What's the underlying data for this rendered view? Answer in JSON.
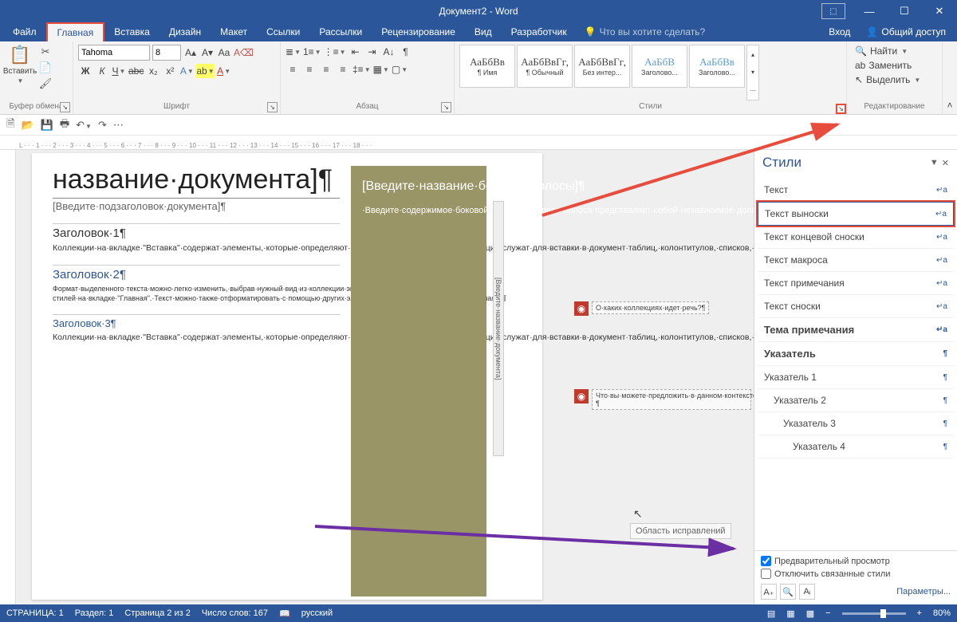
{
  "title": "Документ2 - Word",
  "window": {
    "restore": "🗗",
    "min": "—",
    "max": "☐",
    "close": "✕"
  },
  "tabs": [
    "Файл",
    "Главная",
    "Вставка",
    "Дизайн",
    "Макет",
    "Ссылки",
    "Рассылки",
    "Рецензирование",
    "Вид",
    "Разработчик"
  ],
  "activeTab": 1,
  "tellme": "Что вы хотите сделать?",
  "signin": "Вход",
  "share": "Общий доступ",
  "ribbon": {
    "clipboard": {
      "label": "Буфер обмена",
      "paste": "Вставить"
    },
    "font": {
      "label": "Шрифт",
      "name": "Tahoma",
      "size": "8"
    },
    "paragraph": {
      "label": "Абзац"
    },
    "styles": {
      "label": "Стили",
      "items": [
        {
          "prev": "АаБбВв",
          "name": "¶ Имя"
        },
        {
          "prev": "АаБбВвГг,",
          "name": "¶ Обычный"
        },
        {
          "prev": "АаБбВвГг,",
          "name": "Без интер..."
        },
        {
          "prev": "АаБбВ",
          "name": "Заголово..."
        },
        {
          "prev": "АаБбВв",
          "name": "Заголово..."
        }
      ]
    },
    "editing": {
      "label": "Редактирование",
      "find": "Найти",
      "replace": "Заменить",
      "select": "Выделить"
    }
  },
  "ruler": "L · · · 1 · · · 2 · · · 3 · · · 4 · · · 5 · · · 6 · · · 7 · · · 8 · · · 9 · · · 10 · · · 11 · · · 12 · · · 13 · · · 14 · · · 15 · · · 16 · · · 17 · · · 18 · · ·",
  "doc": {
    "title": "название·документа]¶",
    "subtitle": "[Введите·подзаголовок·документа]¶",
    "h1": "Заголовок·1¶",
    "p1": "Коллекции·на·вкладке·\"Вставка\"·содержат·элементы,·которые·определяют·общий·вид·документа.·Эти·коллекции·служат·для·вставки·в·документ·таблиц,·колонтитулов,·списков,·титульных·страниц·и·других·стандартных·блоков.¶",
    "h2": "Заголовок·2¶",
    "p2": "Формат·выделенного·текста·можно·легко·изменить,·выбрав·нужный·вид·из·коллекции·экспресс-стилей·на·вкладке·\"Главная\".·Текст·можно·также·отформатировать·с·помощью·других·элементов·управления·на·вкладке·\"Главная\".·¶",
    "h3": "Заголовок·3¶",
    "p3": "Коллекции·на·вкладке·\"Вставка\"·содержат·элементы,·которые·определяют·общий·вид·документа.·Эти·коллекции·служат·для·вставки·в·документ·таблиц,·колонтитулов,·списков,·титульных·страниц·и·других·стандартных·блоков.¶",
    "sideTitle": "[Введите·название·боковой·полосы]¶",
    "sideText": "·Введите·содержимое·боковой·полосы.·Боковая·полоса·представляет·собой·независимое·дополнение·к·основному·документу.·Обычно·она·выровнена·по·левому·или·правому·краю·страницы·либо·расположена·в·самом·верху·или·в·",
    "vert": "[Введите·название·документа]",
    "comment1": "О·каких·коллекциях·идет·речь?¶",
    "comment2": "Что·вы·можете·предложить·в·данном·контексте?¶",
    "revLabel": "Область исправлений"
  },
  "stylesPane": {
    "title": "Стили",
    "items": [
      {
        "t": "Текст",
        "m": "↵a"
      },
      {
        "t": "Текст выноски",
        "m": "↵a",
        "sel": true
      },
      {
        "t": "Текст концевой сноски",
        "m": "↵a"
      },
      {
        "t": "Текст макроса",
        "m": "↵a"
      },
      {
        "t": "Текст примечания",
        "m": "↵a"
      },
      {
        "t": "Текст сноски",
        "m": "↵a"
      },
      {
        "t": "Тема примечания",
        "m": "↵a",
        "b": true
      },
      {
        "t": "Указатель",
        "m": "¶",
        "b": true
      },
      {
        "t": "Указатель 1",
        "m": "¶"
      },
      {
        "t": "Указатель 2",
        "m": "¶",
        "i": 1
      },
      {
        "t": "Указатель 3",
        "m": "¶",
        "i": 2
      },
      {
        "t": "Указатель 4",
        "m": "¶",
        "i": 3
      }
    ],
    "preview": "Предварительный просмотр",
    "disable": "Отключить связанные стили",
    "options": "Параметры..."
  },
  "status": {
    "page": "СТРАНИЦА: 1",
    "section": "Раздел: 1",
    "pages": "Страница 2 из 2",
    "words": "Число слов: 167",
    "lang": "русский",
    "zoom": "80%"
  }
}
